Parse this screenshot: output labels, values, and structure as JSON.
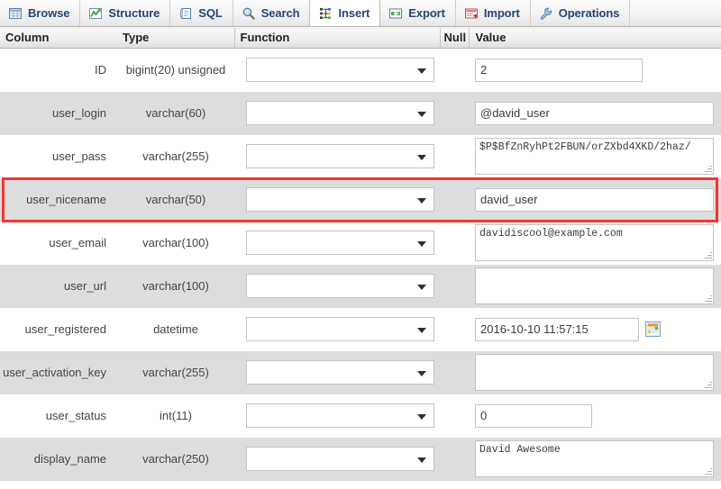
{
  "tabs": [
    {
      "label": "Browse",
      "icon": "browse-icon",
      "active": false
    },
    {
      "label": "Structure",
      "icon": "structure-icon",
      "active": false
    },
    {
      "label": "SQL",
      "icon": "sql-icon",
      "active": false
    },
    {
      "label": "Search",
      "icon": "search-icon",
      "active": false
    },
    {
      "label": "Insert",
      "icon": "insert-icon",
      "active": true
    },
    {
      "label": "Export",
      "icon": "export-icon",
      "active": false
    },
    {
      "label": "Import",
      "icon": "import-icon",
      "active": false
    },
    {
      "label": "Operations",
      "icon": "wrench-icon",
      "active": false
    }
  ],
  "table": {
    "headers": {
      "column": "Column",
      "type": "Type",
      "function": "Function",
      "null": "Null",
      "value": "Value"
    },
    "rows": [
      {
        "column": "ID",
        "type": "bigint(20) unsigned",
        "function": "",
        "null": false,
        "value": "2",
        "widget": "input",
        "value_width": 186,
        "stripe": "odd"
      },
      {
        "column": "user_login",
        "type": "varchar(60)",
        "function": "",
        "null": false,
        "value": "@david_user",
        "widget": "input",
        "value_width": 268,
        "stripe": "even"
      },
      {
        "column": "user_pass",
        "type": "varchar(255)",
        "function": "",
        "null": false,
        "value": "$P$BfZnRyhPt2FBUN/orZXbd4XKD/2haz/",
        "widget": "textarea",
        "value_width": 268,
        "stripe": "odd"
      },
      {
        "column": "user_nicename",
        "type": "varchar(50)",
        "function": "",
        "null": false,
        "value": "david_user",
        "widget": "input",
        "value_width": 268,
        "stripe": "even",
        "highlighted": true
      },
      {
        "column": "user_email",
        "type": "varchar(100)",
        "function": "",
        "null": false,
        "value": "davidiscool@example.com",
        "widget": "textarea",
        "value_width": 268,
        "stripe": "odd"
      },
      {
        "column": "user_url",
        "type": "varchar(100)",
        "function": "",
        "null": false,
        "value": "",
        "widget": "textarea",
        "value_width": 268,
        "stripe": "even"
      },
      {
        "column": "user_registered",
        "type": "datetime",
        "function": "",
        "null": false,
        "value": "2016-10-10 11:57:15",
        "widget": "datetime",
        "value_width": 182,
        "stripe": "odd"
      },
      {
        "column": "user_activation_key",
        "type": "varchar(255)",
        "function": "",
        "null": false,
        "value": "",
        "widget": "textarea",
        "value_width": 268,
        "stripe": "even"
      },
      {
        "column": "user_status",
        "type": "int(11)",
        "function": "",
        "null": false,
        "value": "0",
        "widget": "input",
        "value_width": 130,
        "stripe": "odd"
      },
      {
        "column": "display_name",
        "type": "varchar(250)",
        "function": "",
        "null": false,
        "value": "David Awesome",
        "widget": "textarea",
        "value_width": 268,
        "stripe": "even"
      }
    ]
  },
  "annotation": {
    "highlight_color": "#f4352f",
    "highlight_target": "user_nicename"
  },
  "theme": {
    "tab_text": "#27447a",
    "row_alt_bg": "#dddddd",
    "row_bg": "#ffffff",
    "header_text": "#222222"
  }
}
